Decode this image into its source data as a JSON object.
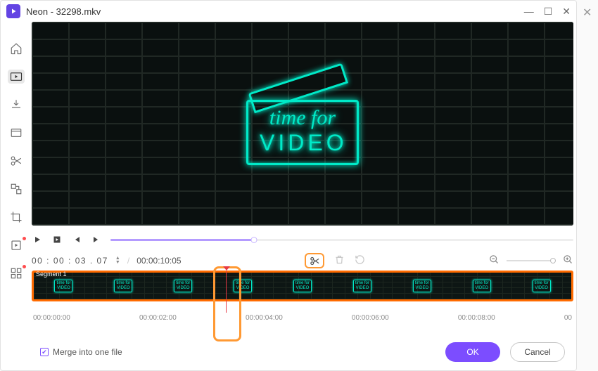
{
  "window": {
    "title": "Neon - 32298.mkv"
  },
  "icons": {
    "home": "home-icon",
    "convert": "convert-icon",
    "download": "download-icon",
    "compress": "compress-icon",
    "cut": "cut-icon",
    "merge": "merge-icon",
    "crop": "crop-icon",
    "effects": "effects-icon",
    "apps": "apps-icon"
  },
  "preview": {
    "neon_line1": "time for",
    "neon_line2": "VIDEO"
  },
  "transport": {
    "progress_pct": 31
  },
  "time": {
    "current_hh": "00",
    "current_mm": "00",
    "current_ss": "03",
    "current_ff": "07",
    "current_display": "00 : 00 : 03 . 07",
    "total": "00:00:10:05"
  },
  "timeline": {
    "segment_label": "Segment 1",
    "thumb_text": "time for\nVIDEO",
    "ticks": [
      "00:00:00:00",
      "00:00:02:00",
      "00:00:04:00",
      "00:00:06:00",
      "00:00:08:00",
      "00"
    ]
  },
  "footer": {
    "merge_label": "Merge into one file",
    "merge_checked": true,
    "ok": "OK",
    "cancel": "Cancel"
  },
  "colors": {
    "accent": "#7c4dff",
    "highlight": "#ff9933",
    "handle": "#ff6b00",
    "neon": "#00eac8"
  }
}
